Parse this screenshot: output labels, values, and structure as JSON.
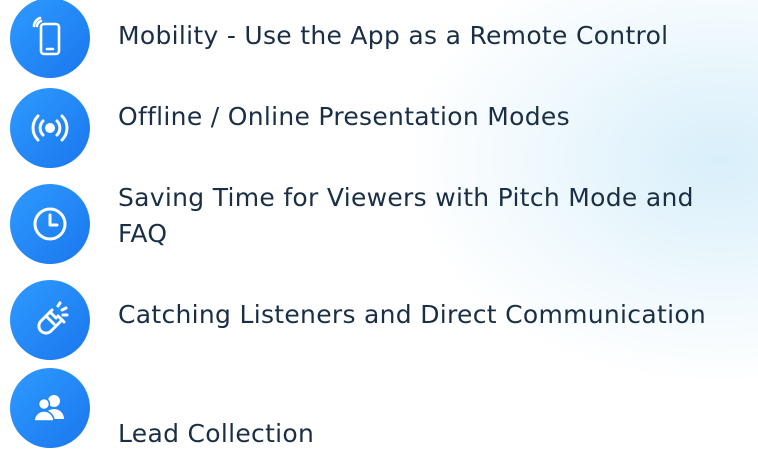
{
  "features": {
    "items": [
      {
        "icon": "smartphone-icon",
        "label": "Mobility - Use the App as a Remote Control"
      },
      {
        "icon": "broadcast-icon",
        "label": "Offline / Online Presentation Modes"
      },
      {
        "icon": "clock-icon",
        "label": "Saving Time for Viewers with Pitch Mode and FAQ"
      },
      {
        "icon": "magnet-icon",
        "label": "Catching Listeners and Direct Communication"
      },
      {
        "icon": "users-icon",
        "label": "Lead Collection"
      }
    ]
  },
  "colors": {
    "icon_background": "#1e86f5",
    "text": "#1a2f45"
  }
}
